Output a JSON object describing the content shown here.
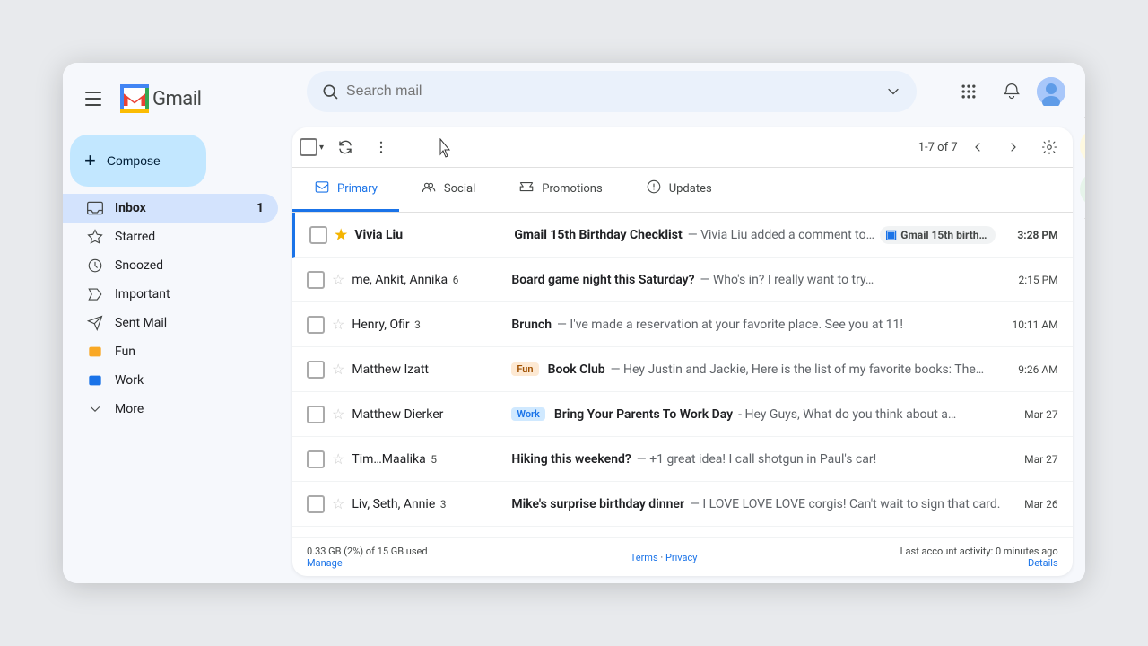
{
  "app": {
    "title": "Gmail",
    "logo_letter": "M"
  },
  "header": {
    "search_placeholder": "Search mail",
    "hamburger_label": "Main menu"
  },
  "compose": {
    "label": "Compose",
    "plus": "+"
  },
  "sidebar": {
    "items": [
      {
        "id": "inbox",
        "label": "Inbox",
        "icon": "inbox",
        "badge": "1",
        "active": true
      },
      {
        "id": "starred",
        "label": "Starred",
        "icon": "star",
        "badge": "",
        "active": false
      },
      {
        "id": "snoozed",
        "label": "Snoozed",
        "icon": "clock",
        "badge": "",
        "active": false
      },
      {
        "id": "important",
        "label": "Important",
        "icon": "label",
        "badge": "",
        "active": false
      },
      {
        "id": "sent",
        "label": "Sent Mail",
        "icon": "send",
        "badge": "",
        "active": false
      },
      {
        "id": "fun",
        "label": "Fun",
        "icon": "label",
        "color": "#f9a825",
        "badge": "",
        "active": false
      },
      {
        "id": "work",
        "label": "Work",
        "icon": "label",
        "color": "#1a73e8",
        "badge": "",
        "active": false
      },
      {
        "id": "more",
        "label": "More",
        "icon": "chevron",
        "badge": "",
        "active": false
      }
    ]
  },
  "toolbar": {
    "select_all_label": "Select all",
    "refresh_label": "Refresh",
    "more_label": "More",
    "pagination": "1-7 of 7",
    "settings_label": "Settings"
  },
  "tabs": [
    {
      "id": "primary",
      "label": "Primary",
      "icon": "inbox",
      "active": true
    },
    {
      "id": "social",
      "label": "Social",
      "icon": "people",
      "active": false
    },
    {
      "id": "promotions",
      "label": "Promotions",
      "icon": "tag",
      "active": false
    },
    {
      "id": "updates",
      "label": "Updates",
      "icon": "info",
      "active": false
    }
  ],
  "emails": [
    {
      "id": 1,
      "sender": "Vivia Liu",
      "count": "",
      "starred": true,
      "subject": "Gmail 15th Birthday Checklist",
      "snippet": "— Vivia Liu added a comment to…",
      "attachment": "Gmail 15th birth…",
      "time": "3:28 PM",
      "unread": true,
      "label": ""
    },
    {
      "id": 2,
      "sender": "me, Ankit, Annika",
      "count": "6",
      "starred": false,
      "subject": "Board game night this Saturday?",
      "snippet": "— Who's in? I really want to try…",
      "attachment": "",
      "time": "2:15 PM",
      "unread": false,
      "label": ""
    },
    {
      "id": 3,
      "sender": "Henry, Ofir",
      "count": "3",
      "starred": false,
      "subject": "Brunch",
      "snippet": "— I've made a reservation at your favorite place. See you at 11!",
      "attachment": "",
      "time": "10:11 AM",
      "unread": false,
      "label": ""
    },
    {
      "id": 4,
      "sender": "Matthew Izatt",
      "count": "",
      "starred": false,
      "subject": "Book Club",
      "snippet": "— Hey Justin and Jackie, Here is the list of my favorite books: The…",
      "attachment": "",
      "time": "9:26 AM",
      "unread": false,
      "label": "Fun"
    },
    {
      "id": 5,
      "sender": "Matthew Dierker",
      "count": "",
      "starred": false,
      "subject": "Bring Your Parents To Work Day",
      "snippet": "- Hey Guys, What do you think about a…",
      "attachment": "",
      "time": "Mar 27",
      "unread": false,
      "label": "Work"
    },
    {
      "id": 6,
      "sender": "Tim…Maalika",
      "count": "5",
      "starred": false,
      "subject": "Hiking this weekend?",
      "snippet": "— +1 great idea! I call shotgun in Paul's car!",
      "attachment": "",
      "time": "Mar 27",
      "unread": false,
      "label": ""
    },
    {
      "id": 7,
      "sender": "Liv, Seth, Annie",
      "count": "3",
      "starred": false,
      "subject": "Mike's surprise birthday dinner",
      "snippet": "— I LOVE LOVE LOVE corgis! Can't wait to sign that card.",
      "attachment": "",
      "time": "Mar 26",
      "unread": false,
      "label": ""
    }
  ],
  "footer": {
    "storage": "0.33 GB (2%) of 15 GB used",
    "manage": "Manage",
    "terms": "Terms",
    "separator": "·",
    "privacy": "Privacy",
    "activity": "Last account activity: 0 minutes ago",
    "details": "Details"
  },
  "right_sidebar": {
    "icons": [
      "calendar",
      "tasks",
      "contacts",
      "plus"
    ]
  }
}
